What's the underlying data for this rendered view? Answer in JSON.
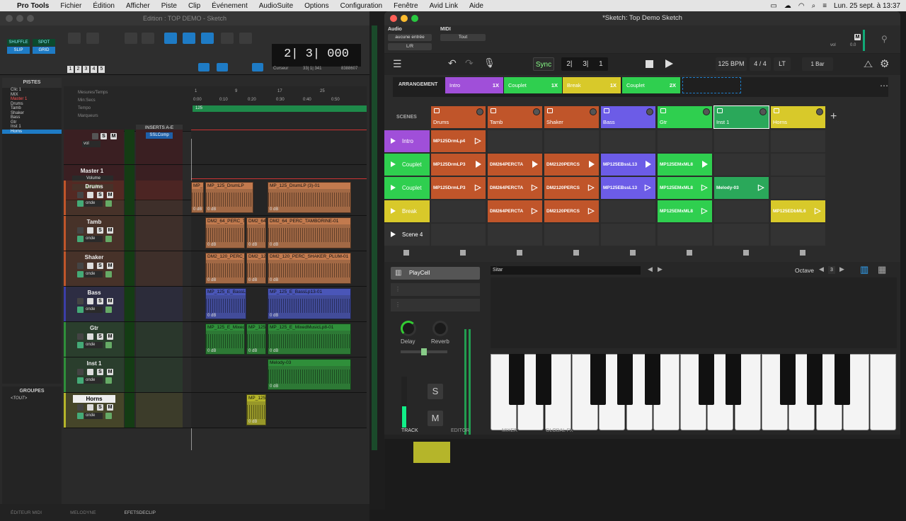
{
  "menubar": {
    "apple": "",
    "app": "Pro Tools",
    "items": [
      "Fichier",
      "Édition",
      "Afficher",
      "Piste",
      "Clip",
      "Événement",
      "AudioSuite",
      "Options",
      "Configuration",
      "Fenêtre",
      "Avid Link",
      "Aide"
    ],
    "datetime": "Lun. 25 sept. à 13:37"
  },
  "protools": {
    "title": "Edition : TOP DEMO - Sketch",
    "modes": [
      "SHUFFLE",
      "SPOT",
      "SLIP",
      "GRID"
    ],
    "counter": "2| 3| 000",
    "cursor_label": "Curseur",
    "cursor_value": "33| 1| 341",
    "cursor_extra": "8388607",
    "num_buttons": [
      "1",
      "2",
      "3",
      "4",
      "5"
    ],
    "tracks_header": "PISTES",
    "track_list": [
      "Clic 1",
      "MIX",
      "Master 1",
      "Drums",
      "Tamb",
      "Shaker",
      "Bass",
      "Gtr",
      "Inst 1",
      "Horns"
    ],
    "groups_header": "GROUPES",
    "groups_item": "<TOUT>",
    "ruler": {
      "rows": [
        "Mesures/Temps",
        "Min:Secs",
        "Tempo",
        "Marqueurs"
      ],
      "bars": [
        "1",
        "9",
        "17",
        "25"
      ],
      "times": [
        "0:00",
        "0:10",
        "0:20",
        "0:30",
        "0:40",
        "0:50"
      ],
      "tempo": "125"
    },
    "inserts_header": "INSERTS A-E",
    "sslcomp": "SSLComp",
    "vol": "vol",
    "volume": "Volume",
    "auto": "auto lire",
    "onde": "onde",
    "tracks": [
      {
        "name": "Clic 1",
        "color": "#b1303a",
        "clips": []
      },
      {
        "name": "Master 1",
        "color": "#b1303a",
        "clips": []
      },
      {
        "name": "Drums",
        "color": "#c0552a",
        "clips": [
          {
            "n": "MP_125",
            "db": "0 dB"
          },
          {
            "n": "MP_125_DrumLP",
            "db": "0 dB"
          },
          {
            "n": "MP_125_DrumLP (3)-01",
            "db": "0 dB"
          }
        ]
      },
      {
        "name": "Tamb",
        "color": "#c0552a",
        "clips": [
          {
            "n": "DM2_64_PERC_T",
            "db": "0 dB"
          },
          {
            "n": "DM2_64",
            "db": "0 dB"
          },
          {
            "n": "DM2_64_PERC_TAMBORINE-01",
            "db": "0 dB"
          }
        ]
      },
      {
        "name": "Shaker",
        "color": "#c0552a",
        "clips": [
          {
            "n": "DM2_120_PERC_",
            "db": "0 dB"
          },
          {
            "n": "DM2_12",
            "db": "0 dB"
          },
          {
            "n": "DM2_120_PERC_SHAKER_PLUM-01",
            "db": "0 dB"
          }
        ]
      },
      {
        "name": "Bass",
        "color": "#3b3ea8",
        "clips": [
          {
            "n": "MP_125_E_BassL",
            "db": "0 dB"
          },
          {
            "n": "MP_125_E_BassLp13-01",
            "db": "0 dB"
          }
        ]
      },
      {
        "name": "Gtr",
        "color": "#2f8f3a",
        "clips": [
          {
            "n": "MP_125_E_Mixed",
            "db": "0 dB"
          },
          {
            "n": "MP_125",
            "db": "0 dB"
          },
          {
            "n": "MP_125_E_MixedMusicLp8-01",
            "db": "0 dB"
          }
        ]
      },
      {
        "name": "Inst 1",
        "color": "#2f8f3a",
        "clips": [
          {
            "n": "Melody-03",
            "db": "0 dB"
          }
        ]
      },
      {
        "name": "Horns",
        "color": "#b5b52a",
        "clips": [
          {
            "n": "MP_125",
            "db": "0 dB"
          }
        ]
      }
    ],
    "footer": [
      "ÉDITEUR MIDI",
      "MELODYNE",
      "EFETSDECLIP"
    ]
  },
  "sketch": {
    "title": "*Sketch: Top Demo Sketch",
    "audio_label": "Audio",
    "midi_label": "MIDI",
    "audio_in": "aucune entrée",
    "audio_out": "L/R",
    "midi_in": "Tout",
    "m_label": "M",
    "vol_label": "vol",
    "vol_value": "0.0",
    "sync": "Sync",
    "position": [
      "2|",
      "3|",
      "1"
    ],
    "bpm": "125 BPM",
    "meter": "4 / 4",
    "lt": "LT",
    "bars": "1 Bar",
    "arrangement_label": "ARRANGEMENT",
    "arrangement": [
      {
        "name": "Intro",
        "rep": "1X",
        "color": "#a04fd9"
      },
      {
        "name": "Couplet",
        "rep": "1X",
        "color": "#2fcf4f"
      },
      {
        "name": "Break",
        "rep": "1X",
        "color": "#d8c92a"
      },
      {
        "name": "Couplet",
        "rep": "2X",
        "color": "#2fcf4f"
      }
    ],
    "scenes_label": "SCENES",
    "columns": [
      {
        "name": "Drums",
        "color": "#c0552a"
      },
      {
        "name": "Tamb",
        "color": "#c0552a"
      },
      {
        "name": "Shaker",
        "color": "#c0552a"
      },
      {
        "name": "Bass",
        "color": "#6c5ce7"
      },
      {
        "name": "Gtr",
        "color": "#2fcf4f"
      },
      {
        "name": "Inst 1",
        "color": "#2aa85a"
      },
      {
        "name": "Horns",
        "color": "#d8c92a"
      }
    ],
    "scenes": [
      {
        "name": "Intro",
        "color": "#a04fd9",
        "cells": [
          "MP125DrmLp4",
          "",
          "",
          "",
          "",
          "",
          ""
        ]
      },
      {
        "name": "Couplet",
        "color": "#2fcf4f",
        "cells": [
          "MP125DrmLP3",
          "DM264PERCTA",
          "DM2120PERCS",
          "MP125EBssL13",
          "MP125EMxML8",
          "",
          ""
        ]
      },
      {
        "name": "Couplet",
        "color": "#2fcf4f",
        "cells": [
          "MP125DrmLP3",
          "DM264PERCTA",
          "DM2120PERCS",
          "MP125EBssL13",
          "MP125EMxML8",
          "Melody-03",
          ""
        ]
      },
      {
        "name": "Break",
        "color": "#d8c92a",
        "cells": [
          "",
          "DM264PERCTA",
          "DM2120PERCS",
          "",
          "MP125EMxML8",
          "",
          "MP125EDbML6"
        ]
      },
      {
        "name": "Scene 4",
        "color": "#333333",
        "cells": [
          "",
          "",
          "",
          "",
          "",
          "",
          ""
        ]
      }
    ],
    "playcell": "PlayCell",
    "instrument": "Sitar",
    "octave_label": "Octave",
    "octave_value": "3",
    "delay": "Delay",
    "reverb": "Reverb",
    "solo": "S",
    "mute": "M",
    "tabs": [
      "TRACK",
      "EDITOR",
      "MIXER",
      "GLOBAL FX"
    ]
  }
}
